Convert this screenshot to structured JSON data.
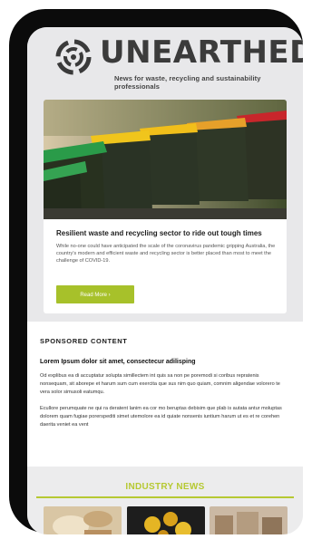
{
  "brand": {
    "name": "UNEARTHED",
    "tagline": "News for waste, recycling and sustainability professionals"
  },
  "feature": {
    "title": "Resilient waste and recycling sector to ride out tough times",
    "body": "While no-one could have anticipated the scale of the coronavirus pandemic gripping Australia, the country's modern and efficient waste and recycling sector is better placed than most to meet the challenge of COVID-19.",
    "cta": "Read More ›"
  },
  "sponsored": {
    "heading": "SPONSORED CONTENT",
    "title": "Lorem Ipsum dolor sit amet, consectecur adilisping",
    "paragraph1": "Od explibus ea di accuptatur solupta simillectem int quis sa non pe poremodi si coribus repratenis nonsequam, sit aborepe et harum sum cum exercita que sus nim quo quiam, comnim aligendae volorero te vera solor simusoli eatumqu.",
    "paragraph2": "Ecullore perumquate ne qui ra deratent lanim ea cor mo beruptas debisim que plab is autata antur moluptas dolorem quam fugiae porerspediti simet utemolore ea id quiate nonsenis iuntium harum ut es et re corehen daerita veniet ea vent"
  },
  "industry": {
    "title": "INDUSTRY NEWS"
  },
  "colors": {
    "accent": "#a7c12a",
    "phone_frame": "#0b0b0b",
    "background": "#e8e8ea"
  }
}
